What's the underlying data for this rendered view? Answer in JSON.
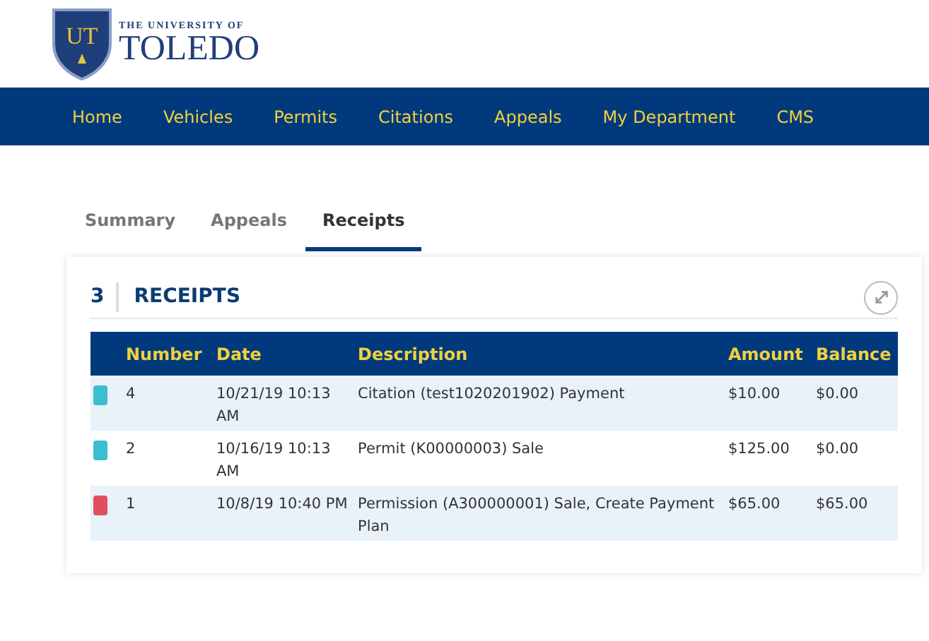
{
  "logo": {
    "line1": "THE UNIVERSITY OF",
    "line2": "TOLEDO",
    "monogram": "UT"
  },
  "nav": [
    "Home",
    "Vehicles",
    "Permits",
    "Citations",
    "Appeals",
    "My Department",
    "CMS"
  ],
  "tabs": [
    {
      "label": "Summary",
      "selected": false
    },
    {
      "label": "Appeals",
      "selected": false
    },
    {
      "label": "Receipts",
      "selected": true
    }
  ],
  "card": {
    "count": "3",
    "title": "RECEIPTS"
  },
  "table": {
    "columns": [
      "Number",
      "Date",
      "Description",
      "Amount",
      "Balance"
    ],
    "rows": [
      {
        "color": "#3bbfcf",
        "cells": [
          "4",
          "10/21/19 10:13 AM",
          "Citation (test1020201902) Payment",
          "$10.00",
          "$0.00"
        ]
      },
      {
        "color": "#3bbfcf",
        "cells": [
          "2",
          "10/16/19 10:13 AM",
          "Permit (K00000003) Sale",
          "$125.00",
          "$0.00"
        ]
      },
      {
        "color": "#e04f5f",
        "cells": [
          "1",
          "10/8/19 10:40 PM",
          "Permission (A300000001) Sale, Create Payment Plan",
          "$65.00",
          "$65.00"
        ]
      }
    ]
  }
}
